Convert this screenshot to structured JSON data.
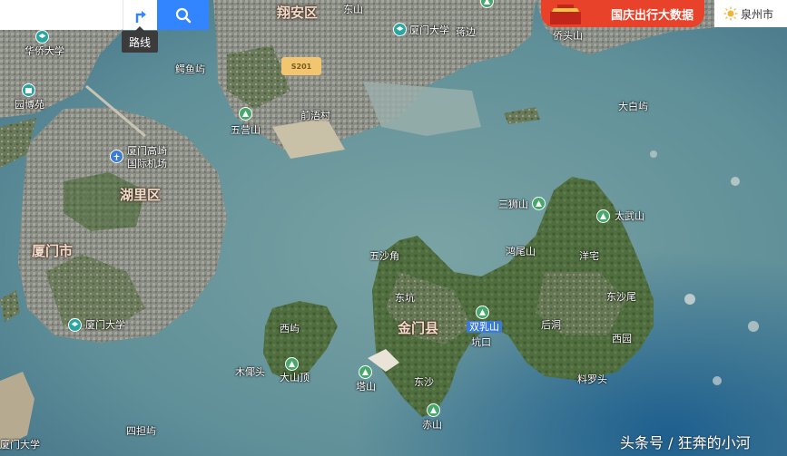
{
  "toolbar": {
    "search_placeholder": "",
    "route_tooltip": "路线",
    "banner_text": "国庆出行大数据",
    "city": "泉州市"
  },
  "map": {
    "road_badge": "S201",
    "watermark": "头条号 / 狂奔的小河",
    "labels": {
      "huaqiao": "华侨大学",
      "yuanbo": "园博苑",
      "gaoqi": "厦门高崎",
      "airport": "国际机场",
      "huli": "湖里区",
      "xiamenshi": "厦门市",
      "xmu_siming": "厦门大学",
      "xmu_bottom": "厦门大学",
      "xiangan": "翔安区",
      "dongshan": "东山",
      "xmu_xiangan": "厦门大学",
      "jiangbian": "蒋边",
      "qiaotoushan": "侨头山",
      "yanyuyu": "鳄鱼屿",
      "wuying": "五营山",
      "xinxiancun": "前浯村",
      "dabaiyu": "大白屿",
      "sanshishan": "三狮山",
      "taiwushan": "太武山",
      "wushajiao": "五沙角",
      "yaowei": "洋宅",
      "hongmushan": "鸿尾山",
      "dongkeng": "东坑",
      "jinmen": "金门县",
      "shuangrushan": "双乳山",
      "keng": "坑口",
      "houshui": "后洞",
      "dongshawei": "东沙尾",
      "xinan": "西园",
      "xiyu": "西屿",
      "mulu": "木倻头",
      "dashanding": "大山顶",
      "tashan": "塔山",
      "dongsha": "东沙",
      "chishan": "赤山",
      "liaoluotou": "料罗头",
      "sijiaoyu": "四担屿"
    }
  }
}
